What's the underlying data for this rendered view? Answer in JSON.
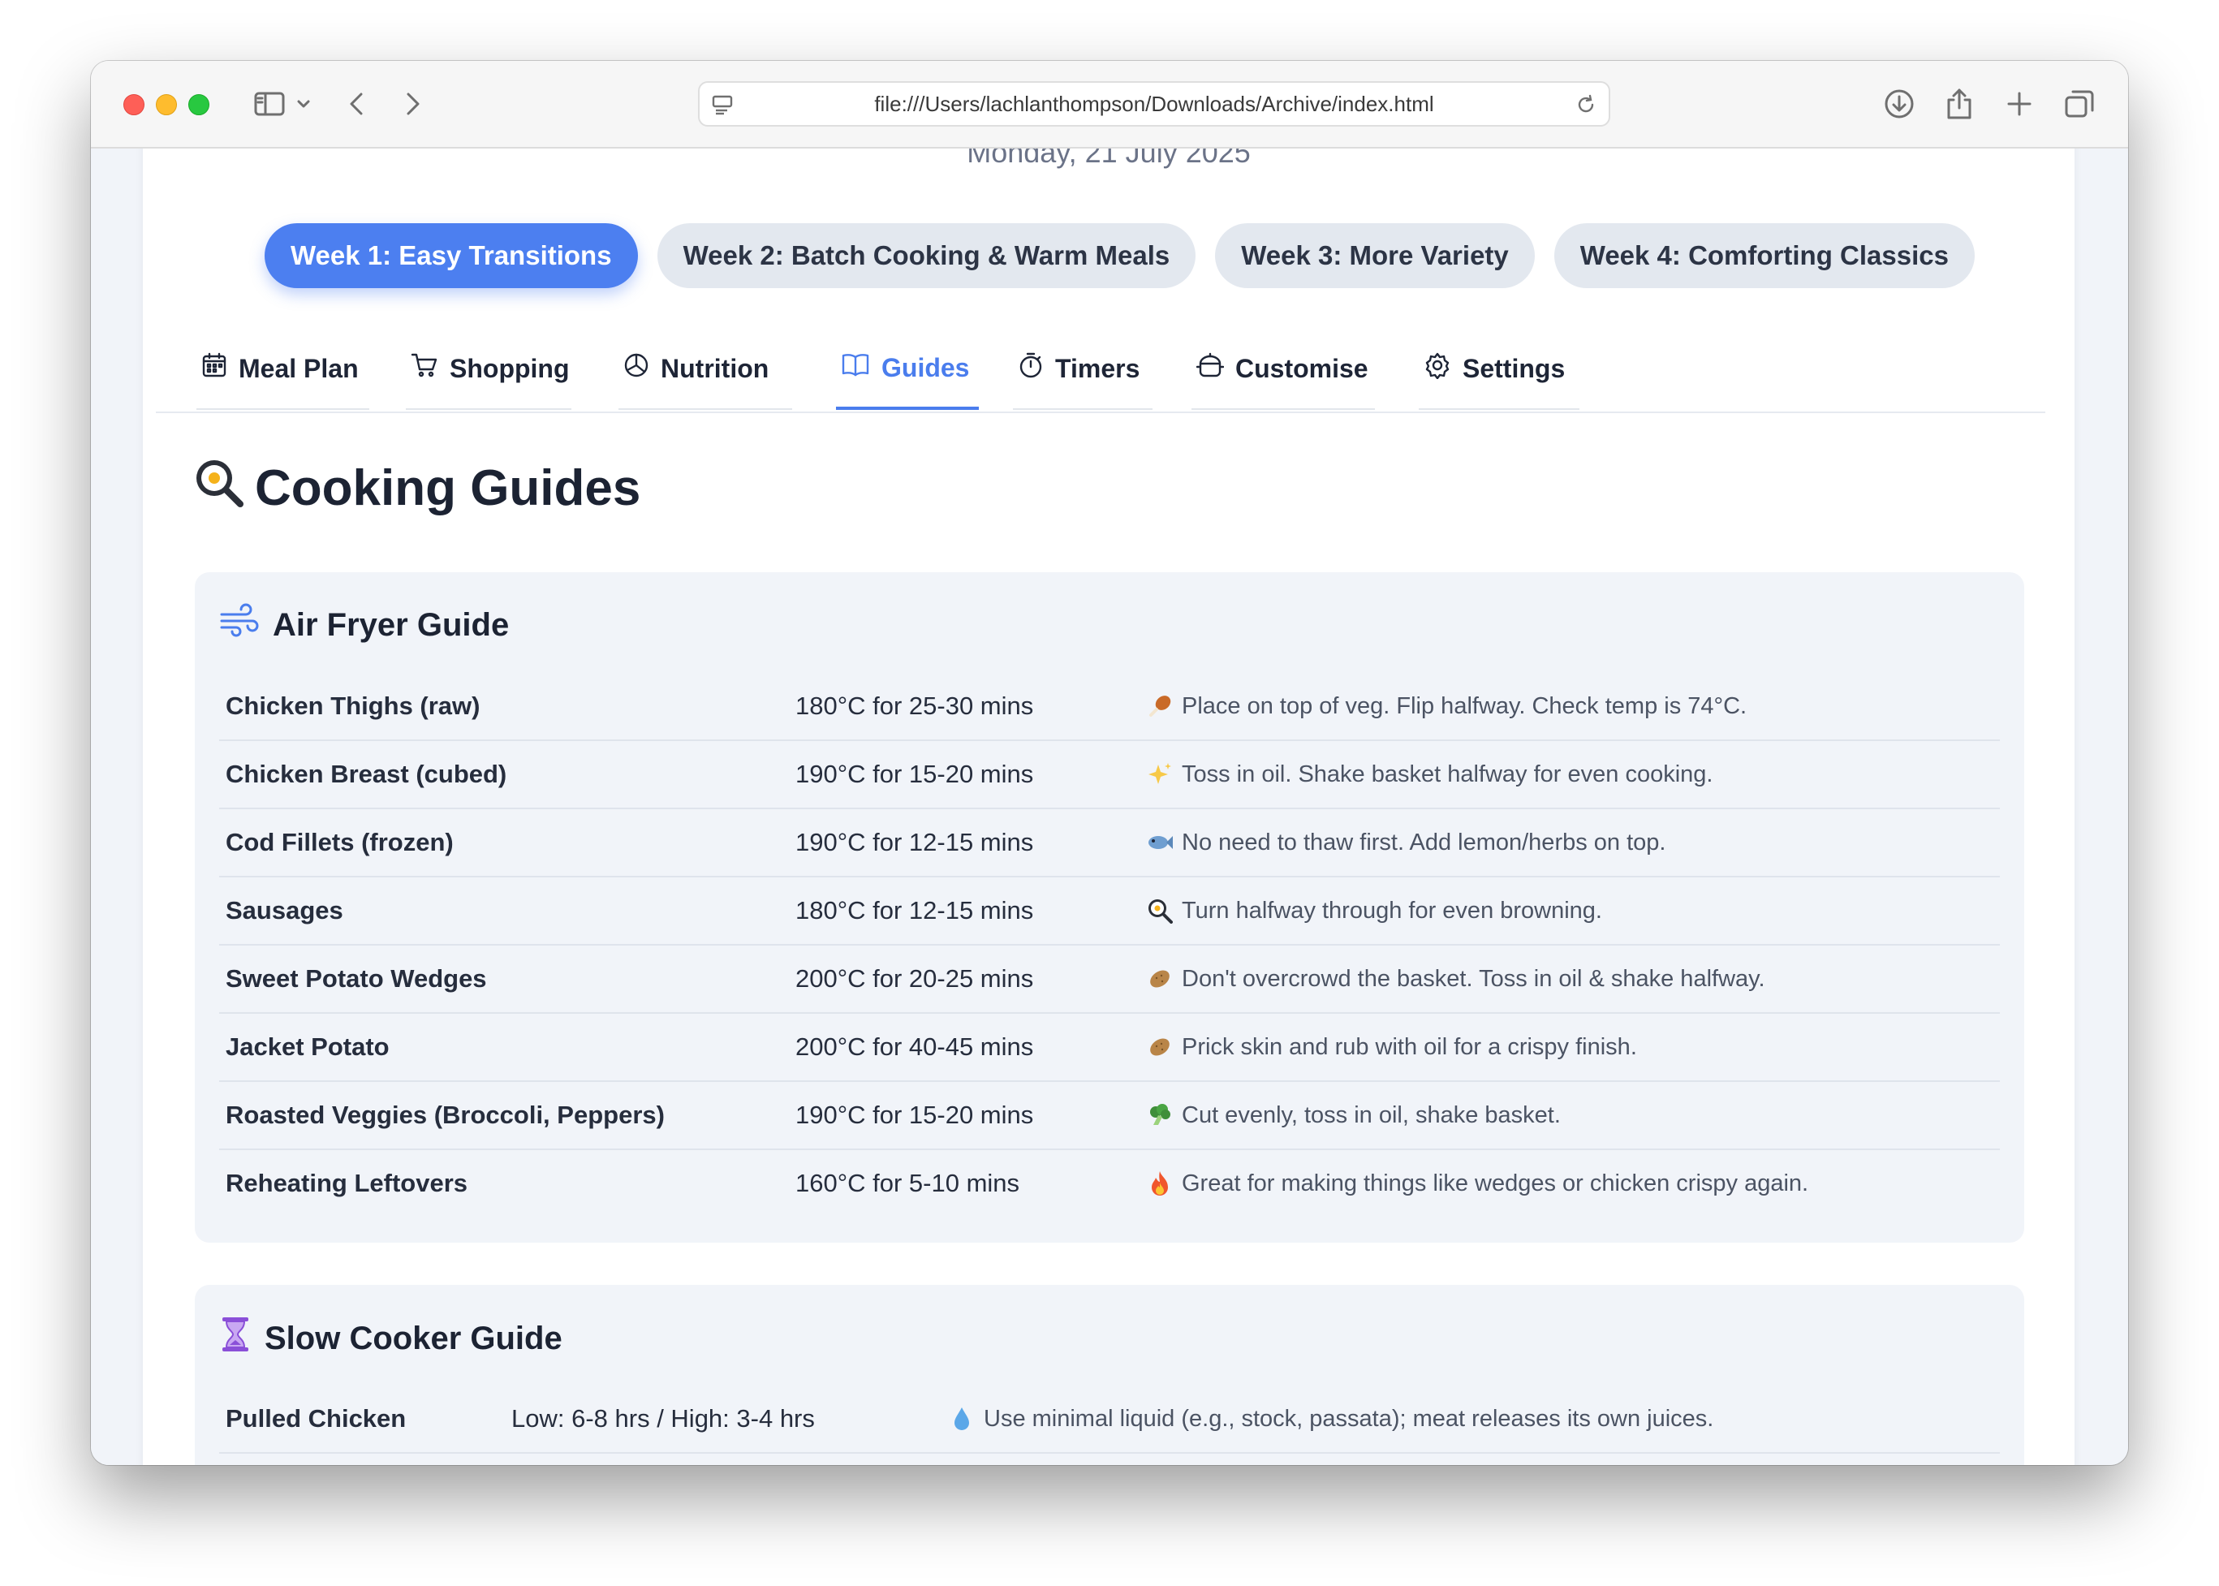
{
  "browser": {
    "url": "file:///Users/lachlanthompson/Downloads/Archive/index.html"
  },
  "page": {
    "date": "Monday, 21 July 2025",
    "week_tabs": [
      {
        "label": "Week 1: Easy Transitions",
        "active": true
      },
      {
        "label": "Week 2: Batch Cooking & Warm Meals",
        "active": false
      },
      {
        "label": "Week 3: More Variety",
        "active": false
      },
      {
        "label": "Week 4: Comforting Classics",
        "active": false
      }
    ],
    "nav_tabs": [
      {
        "label": "Meal Plan",
        "icon": "calendar-icon"
      },
      {
        "label": "Shopping",
        "icon": "cart-icon"
      },
      {
        "label": "Nutrition",
        "icon": "pie-chart-icon"
      },
      {
        "label": "Guides",
        "icon": "book-icon",
        "active": true
      },
      {
        "label": "Timers",
        "icon": "stopwatch-icon"
      },
      {
        "label": "Customise",
        "icon": "cooking-pot-icon"
      },
      {
        "label": "Settings",
        "icon": "gear-icon"
      }
    ],
    "section_title": "Cooking Guides",
    "section_icon": "frying-pan-icon"
  },
  "air_fryer": {
    "title": "Air Fryer Guide",
    "icon": "wind-icon",
    "rows": [
      {
        "food": "Chicken Thighs (raw)",
        "time": "180°C for 25-30 mins",
        "emoji": "poultry-leg-icon",
        "note": "Place on top of veg. Flip halfway. Check temp is 74°C."
      },
      {
        "food": "Chicken Breast (cubed)",
        "time": "190°C for 15-20 mins",
        "emoji": "sparkles-icon",
        "note": "Toss in oil. Shake basket halfway for even cooking."
      },
      {
        "food": "Cod Fillets (frozen)",
        "time": "190°C for 12-15 mins",
        "emoji": "fish-icon",
        "note": "No need to thaw first. Add lemon/herbs on top."
      },
      {
        "food": "Sausages",
        "time": "180°C for 12-15 mins",
        "emoji": "frying-pan-icon",
        "note": "Turn halfway through for even browning."
      },
      {
        "food": "Sweet Potato Wedges",
        "time": "200°C for 20-25 mins",
        "emoji": "potato-icon",
        "note": "Don't overcrowd the basket. Toss in oil & shake halfway."
      },
      {
        "food": "Jacket Potato",
        "time": "200°C for 40-45 mins",
        "emoji": "potato-icon",
        "note": "Prick skin and rub with oil for a crispy finish."
      },
      {
        "food": "Roasted Veggies (Broccoli, Peppers)",
        "time": "190°C for 15-20 mins",
        "emoji": "broccoli-icon",
        "note": "Cut evenly, toss in oil, shake basket."
      },
      {
        "food": "Reheating Leftovers",
        "time": "160°C for 5-10 mins",
        "emoji": "fire-icon",
        "note": "Great for making things like wedges or chicken crispy again."
      }
    ]
  },
  "slow_cooker": {
    "title": "Slow Cooker Guide",
    "icon": "hourglass-icon",
    "rows": [
      {
        "food": "Pulled Chicken",
        "time": "Low: 6-8 hrs / High: 3-4 hrs",
        "emoji": "droplet-icon",
        "note": "Use minimal liquid (e.g., stock, passata); meat releases its own juices."
      }
    ]
  }
}
